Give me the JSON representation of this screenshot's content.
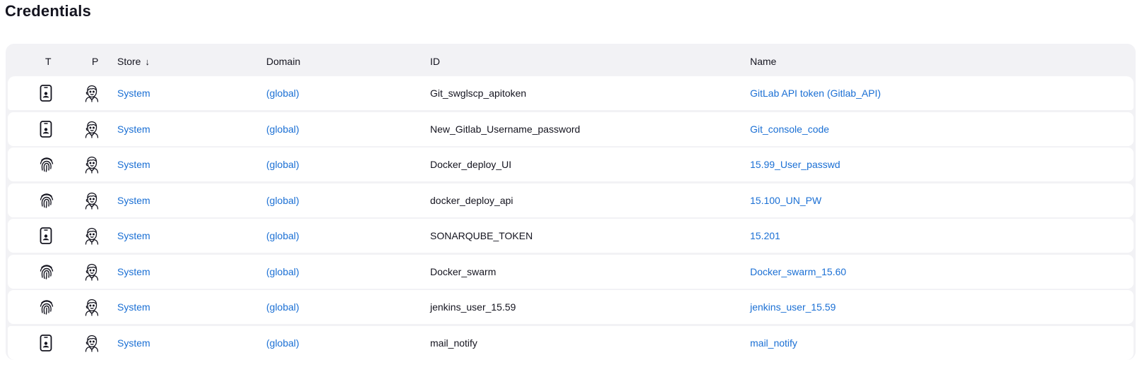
{
  "page": {
    "title": "Credentials"
  },
  "table": {
    "columns": {
      "t": "T",
      "p": "P",
      "store": "Store",
      "store_sort_icon": "↓",
      "domain": "Domain",
      "id": "ID",
      "name": "Name"
    },
    "rows": [
      {
        "type_icon": "mobile-id-icon",
        "provider_icon": "jenkins-butler-icon",
        "store": "System",
        "domain": "(global)",
        "id": "Git_swglscp_apitoken",
        "name": "GitLab API token (Gitlab_API)"
      },
      {
        "type_icon": "mobile-id-icon",
        "provider_icon": "jenkins-butler-icon",
        "store": "System",
        "domain": "(global)",
        "id": "New_Gitlab_Username_password",
        "name": "Git_console_code"
      },
      {
        "type_icon": "fingerprint-icon",
        "provider_icon": "jenkins-butler-icon",
        "store": "System",
        "domain": "(global)",
        "id": "Docker_deploy_UI",
        "name": "15.99_User_passwd"
      },
      {
        "type_icon": "fingerprint-icon",
        "provider_icon": "jenkins-butler-icon",
        "store": "System",
        "domain": "(global)",
        "id": "docker_deploy_api",
        "name": "15.100_UN_PW"
      },
      {
        "type_icon": "mobile-id-icon",
        "provider_icon": "jenkins-butler-icon",
        "store": "System",
        "domain": "(global)",
        "id": "SONARQUBE_TOKEN",
        "name": "15.201"
      },
      {
        "type_icon": "fingerprint-icon",
        "provider_icon": "jenkins-butler-icon",
        "store": "System",
        "domain": "(global)",
        "id": "Docker_swarm",
        "name": "Docker_swarm_15.60"
      },
      {
        "type_icon": "fingerprint-icon",
        "provider_icon": "jenkins-butler-icon",
        "store": "System",
        "domain": "(global)",
        "id": "jenkins_user_15.59",
        "name": "jenkins_user_15.59"
      },
      {
        "type_icon": "mobile-id-icon",
        "provider_icon": "jenkins-butler-icon",
        "store": "System",
        "domain": "(global)",
        "id": "mail_notify",
        "name": "mail_notify"
      }
    ]
  },
  "colors": {
    "link": "#1a6fd4",
    "table_bg": "#f2f2f5",
    "text": "#14141f"
  }
}
